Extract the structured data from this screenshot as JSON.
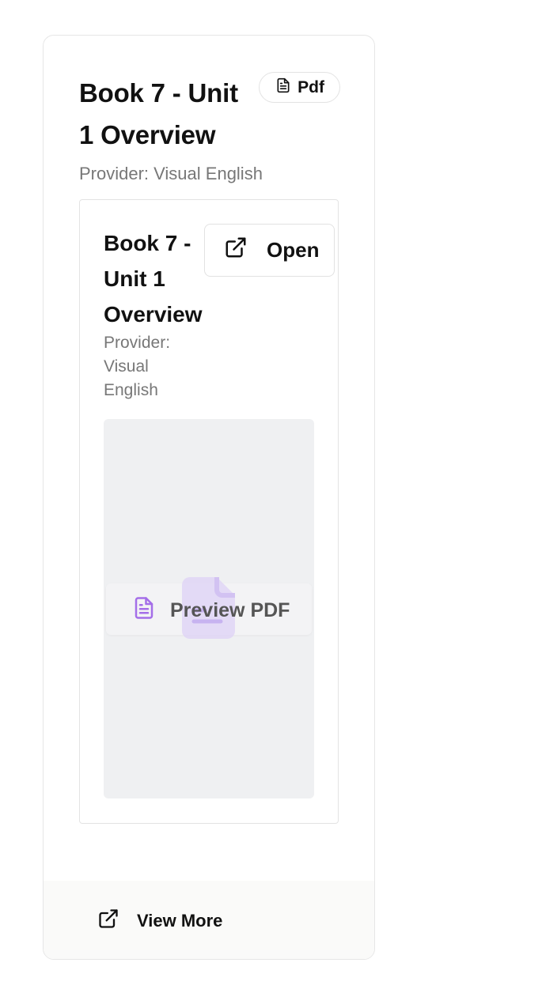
{
  "card": {
    "title": "Book 7 - Unit 1 Overview",
    "badge_label": "Pdf",
    "badge_icon": "file-text-icon",
    "provider": "Provider: Visual English"
  },
  "inner_card": {
    "title": "Book 7 - Unit 1 Overview",
    "provider": "Provider: Visual English",
    "open_label": "Open",
    "open_icon": "external-link-icon",
    "preview_label": "Preview PDF",
    "preview_icon": "file-text-icon",
    "accent_color": "#a46ee8"
  },
  "footer": {
    "view_more_label": "View More",
    "view_more_icon": "external-link-icon"
  }
}
